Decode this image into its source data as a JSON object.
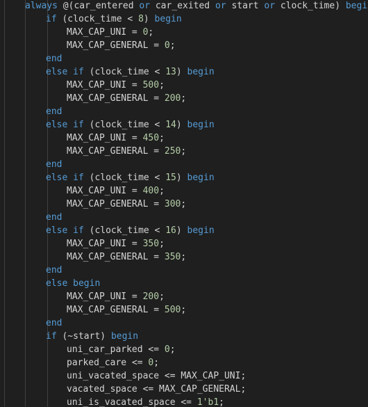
{
  "colors": {
    "background": "#1f1f1f",
    "keyword": "#569cd6",
    "text": "#d4d4d4",
    "number": "#b5cea8",
    "indent_guide": "#404040"
  },
  "lines": [
    [
      {
        "t": "always ",
        "c": "kw"
      },
      {
        "t": "@(",
        "c": "txt"
      },
      {
        "t": "car_entered",
        "c": "txt"
      },
      {
        "t": " or ",
        "c": "kw"
      },
      {
        "t": "car_exited",
        "c": "txt"
      },
      {
        "t": " or ",
        "c": "kw"
      },
      {
        "t": "start",
        "c": "txt"
      },
      {
        "t": " or ",
        "c": "kw"
      },
      {
        "t": "clock_time",
        "c": "txt"
      },
      {
        "t": ") ",
        "c": "txt"
      },
      {
        "t": "begin",
        "c": "kw"
      }
    ],
    [
      {
        "t": "if ",
        "c": "kw"
      },
      {
        "t": "(clock_time < ",
        "c": "txt"
      },
      {
        "t": "8",
        "c": "num"
      },
      {
        "t": ") ",
        "c": "txt"
      },
      {
        "t": "begin",
        "c": "kw"
      }
    ],
    [
      {
        "t": "MAX_CAP_UNI = ",
        "c": "txt"
      },
      {
        "t": "0",
        "c": "num"
      },
      {
        "t": ";",
        "c": "txt"
      }
    ],
    [
      {
        "t": "MAX_CAP_GENERAL = ",
        "c": "txt"
      },
      {
        "t": "0",
        "c": "num"
      },
      {
        "t": ";",
        "c": "txt"
      }
    ],
    [
      {
        "t": "end",
        "c": "kw"
      }
    ],
    [
      {
        "t": "else if ",
        "c": "kw"
      },
      {
        "t": "(clock_time < ",
        "c": "txt"
      },
      {
        "t": "13",
        "c": "num"
      },
      {
        "t": ") ",
        "c": "txt"
      },
      {
        "t": "begin",
        "c": "kw"
      }
    ],
    [
      {
        "t": "MAX_CAP_UNI = ",
        "c": "txt"
      },
      {
        "t": "500",
        "c": "num"
      },
      {
        "t": ";",
        "c": "txt"
      }
    ],
    [
      {
        "t": "MAX_CAP_GENERAL = ",
        "c": "txt"
      },
      {
        "t": "200",
        "c": "num"
      },
      {
        "t": ";",
        "c": "txt"
      }
    ],
    [
      {
        "t": "end",
        "c": "kw"
      }
    ],
    [
      {
        "t": "else if ",
        "c": "kw"
      },
      {
        "t": "(clock_time < ",
        "c": "txt"
      },
      {
        "t": "14",
        "c": "num"
      },
      {
        "t": ") ",
        "c": "txt"
      },
      {
        "t": "begin",
        "c": "kw"
      }
    ],
    [
      {
        "t": "MAX_CAP_UNI = ",
        "c": "txt"
      },
      {
        "t": "450",
        "c": "num"
      },
      {
        "t": ";",
        "c": "txt"
      }
    ],
    [
      {
        "t": "MAX_CAP_GENERAL = ",
        "c": "txt"
      },
      {
        "t": "250",
        "c": "num"
      },
      {
        "t": ";",
        "c": "txt"
      }
    ],
    [
      {
        "t": "end",
        "c": "kw"
      }
    ],
    [
      {
        "t": "else if ",
        "c": "kw"
      },
      {
        "t": "(clock_time < ",
        "c": "txt"
      },
      {
        "t": "15",
        "c": "num"
      },
      {
        "t": ") ",
        "c": "txt"
      },
      {
        "t": "begin",
        "c": "kw"
      }
    ],
    [
      {
        "t": "MAX_CAP_UNI = ",
        "c": "txt"
      },
      {
        "t": "400",
        "c": "num"
      },
      {
        "t": ";",
        "c": "txt"
      }
    ],
    [
      {
        "t": "MAX_CAP_GENERAL = ",
        "c": "txt"
      },
      {
        "t": "300",
        "c": "num"
      },
      {
        "t": ";",
        "c": "txt"
      }
    ],
    [
      {
        "t": "end",
        "c": "kw"
      }
    ],
    [
      {
        "t": "else if ",
        "c": "kw"
      },
      {
        "t": "(clock_time < ",
        "c": "txt"
      },
      {
        "t": "16",
        "c": "num"
      },
      {
        "t": ") ",
        "c": "txt"
      },
      {
        "t": "begin",
        "c": "kw"
      }
    ],
    [
      {
        "t": "MAX_CAP_UNI = ",
        "c": "txt"
      },
      {
        "t": "350",
        "c": "num"
      },
      {
        "t": ";",
        "c": "txt"
      }
    ],
    [
      {
        "t": "MAX_CAP_GENERAL = ",
        "c": "txt"
      },
      {
        "t": "350",
        "c": "num"
      },
      {
        "t": ";",
        "c": "txt"
      }
    ],
    [
      {
        "t": "end",
        "c": "kw"
      }
    ],
    [
      {
        "t": "else begin",
        "c": "kw"
      }
    ],
    [
      {
        "t": "MAX_CAP_UNI = ",
        "c": "txt"
      },
      {
        "t": "200",
        "c": "num"
      },
      {
        "t": ";",
        "c": "txt"
      }
    ],
    [
      {
        "t": "MAX_CAP_GENERAL = ",
        "c": "txt"
      },
      {
        "t": "500",
        "c": "num"
      },
      {
        "t": ";",
        "c": "txt"
      }
    ],
    [
      {
        "t": "end",
        "c": "kw"
      }
    ],
    [
      {
        "t": "if ",
        "c": "kw"
      },
      {
        "t": "(~start) ",
        "c": "txt"
      },
      {
        "t": "begin",
        "c": "kw"
      }
    ],
    [
      {
        "t": "uni_car_parked <= ",
        "c": "txt"
      },
      {
        "t": "0",
        "c": "num"
      },
      {
        "t": ";",
        "c": "txt"
      }
    ],
    [
      {
        "t": "parked_care <= ",
        "c": "txt"
      },
      {
        "t": "0",
        "c": "num"
      },
      {
        "t": ";",
        "c": "txt"
      }
    ],
    [
      {
        "t": "uni_vacated_space <= MAX_CAP_UNI;",
        "c": "txt"
      }
    ],
    [
      {
        "t": "vacated_space <= MAX_CAP_GENERAL;",
        "c": "txt"
      }
    ],
    [
      {
        "t": "uni_is_vacated_space <= ",
        "c": "txt"
      },
      {
        "t": "1'b1",
        "c": "num"
      },
      {
        "t": ";",
        "c": "txt"
      }
    ]
  ]
}
